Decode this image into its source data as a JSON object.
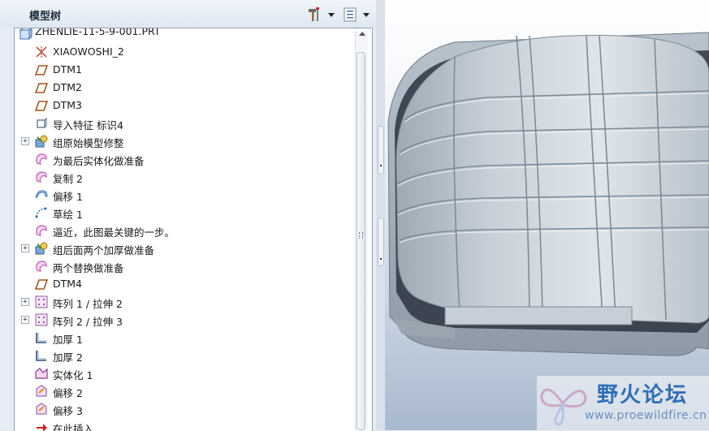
{
  "panel": {
    "title": "模型树",
    "tools_icon": "hammer-settings-icon",
    "display_icon": "tree-display-icon"
  },
  "tree": {
    "root": {
      "label": "ZHENLIE-11-5-9-001.PRT",
      "icon": "part-icon"
    },
    "items": [
      {
        "label": "XIAOWOSHI_2",
        "icon": "coordinate-system-icon",
        "expandable": false
      },
      {
        "label": "DTM1",
        "icon": "datum-plane-icon",
        "expandable": false
      },
      {
        "label": "DTM2",
        "icon": "datum-plane-icon",
        "expandable": false
      },
      {
        "label": "DTM3",
        "icon": "datum-plane-icon",
        "expandable": false
      },
      {
        "label": "导入特征 标识4",
        "icon": "import-feature-icon",
        "expandable": false
      },
      {
        "label": "组原始模型修整",
        "icon": "group-icon",
        "expandable": true
      },
      {
        "label": "为最后实体化做准备",
        "icon": "copy-surface-icon",
        "expandable": false
      },
      {
        "label": "复制 2",
        "icon": "copy-surface-icon",
        "expandable": false
      },
      {
        "label": "偏移 1",
        "icon": "offset-icon",
        "expandable": false
      },
      {
        "label": "草绘 1",
        "icon": "sketch-icon",
        "expandable": false
      },
      {
        "label": "逼近，此图最关键的一步。",
        "icon": "copy-surface-icon",
        "expandable": false
      },
      {
        "label": "组后面两个加厚做准备",
        "icon": "group-icon",
        "expandable": true
      },
      {
        "label": "两个替换做准备",
        "icon": "copy-surface-icon",
        "expandable": false
      },
      {
        "label": "DTM4",
        "icon": "datum-plane-icon",
        "expandable": false
      },
      {
        "label": "阵列 1 / 拉伸 2",
        "icon": "pattern-icon",
        "expandable": true
      },
      {
        "label": "阵列 2 / 拉伸 3",
        "icon": "pattern-icon",
        "expandable": true
      },
      {
        "label": "加厚 1",
        "icon": "thicken-icon",
        "expandable": false
      },
      {
        "label": "加厚 2",
        "icon": "thicken-icon",
        "expandable": false
      },
      {
        "label": "实体化 1",
        "icon": "solidify-icon",
        "expandable": false
      },
      {
        "label": "偏移 2",
        "icon": "offset-replace-icon",
        "expandable": false
      },
      {
        "label": "偏移 3",
        "icon": "offset-replace-icon",
        "expandable": false
      },
      {
        "label": "在此插入",
        "icon": "insert-here-arrow-icon",
        "expandable": false
      }
    ]
  },
  "watermark": {
    "title": "野火论坛",
    "url": "www.proewildfire.cn"
  },
  "colors": {
    "panel_bg": "#e7edf5",
    "model_gray": "#b9c4cd",
    "accent_blue": "#2f6fb6"
  }
}
